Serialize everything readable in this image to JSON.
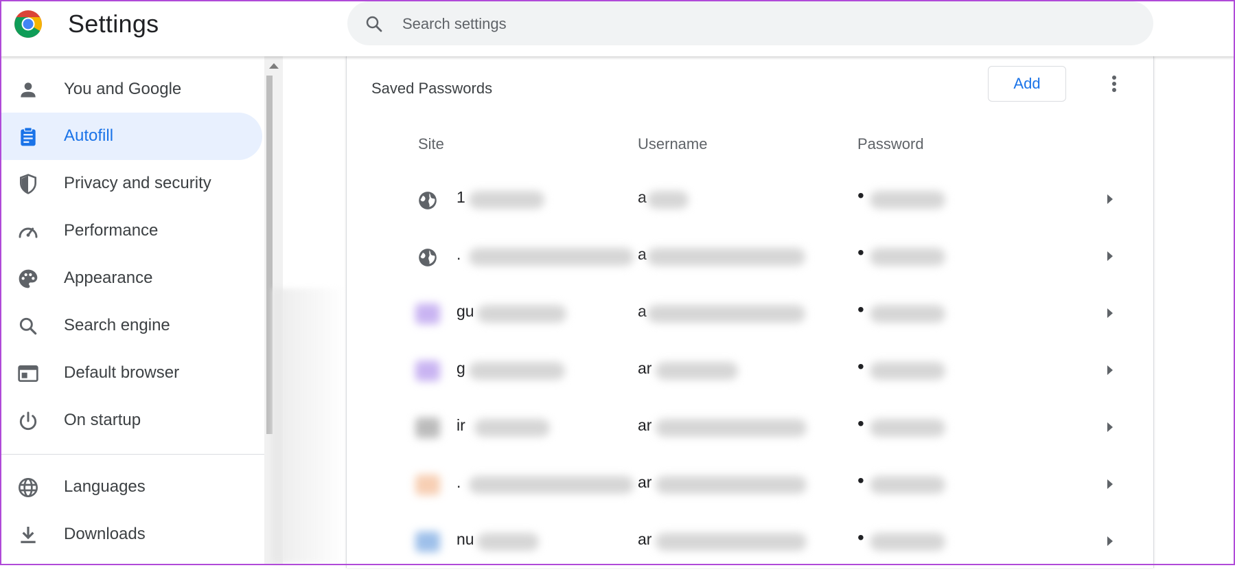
{
  "header": {
    "app_title": "Settings",
    "search_placeholder": "Search settings"
  },
  "sidebar": {
    "items": [
      {
        "label": "You and Google",
        "icon": "person-icon",
        "active": false
      },
      {
        "label": "Autofill",
        "icon": "clipboard-icon",
        "active": true
      },
      {
        "label": "Privacy and security",
        "icon": "shield-icon",
        "active": false
      },
      {
        "label": "Performance",
        "icon": "speedometer-icon",
        "active": false
      },
      {
        "label": "Appearance",
        "icon": "palette-icon",
        "active": false
      },
      {
        "label": "Search engine",
        "icon": "search-icon",
        "active": false
      },
      {
        "label": "Default browser",
        "icon": "browser-window-icon",
        "active": false
      },
      {
        "label": "On startup",
        "icon": "power-icon",
        "active": false
      },
      {
        "label": "Languages",
        "icon": "globe-icon",
        "active": false
      },
      {
        "label": "Downloads",
        "icon": "download-icon",
        "active": false
      }
    ]
  },
  "passwords": {
    "title": "Saved Passwords",
    "add_label": "Add",
    "columns": {
      "site": "Site",
      "username": "Username",
      "password": "Password"
    },
    "rows": [
      {
        "site": "1",
        "username": "a",
        "password": "•"
      },
      {
        "site": ".",
        "username": "a",
        "password": "•"
      },
      {
        "site": "gu",
        "username": "a",
        "password": "•"
      },
      {
        "site": "g",
        "username": "ar",
        "password": "•"
      },
      {
        "site": "ir",
        "username": "ar",
        "password": "•"
      },
      {
        "site": ".",
        "username": "ar",
        "password": "•"
      },
      {
        "site": "nu",
        "username": "ar",
        "password": "•"
      }
    ]
  },
  "colors": {
    "accent": "#1a73e8",
    "active_bg": "#e8f0fe",
    "border": "#b04ad8"
  }
}
